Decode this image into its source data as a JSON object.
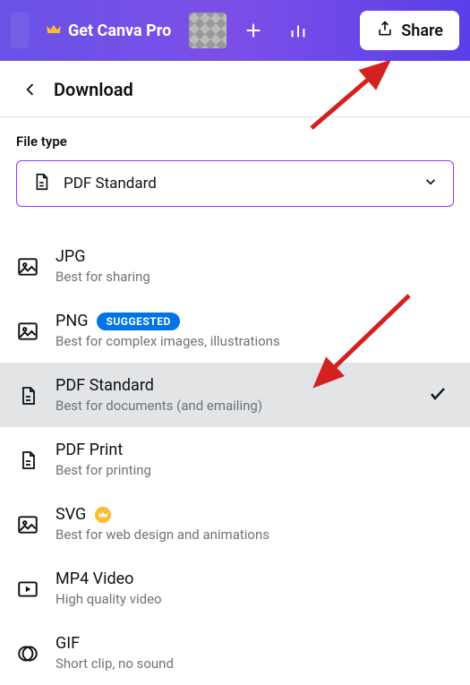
{
  "topbar": {
    "get_pro_label": "Get Canva Pro",
    "share_label": "Share"
  },
  "panel": {
    "title": "Download"
  },
  "file_type": {
    "label": "File type",
    "selected": "PDF Standard"
  },
  "options": [
    {
      "id": "jpg",
      "title": "JPG",
      "subtitle": "Best for sharing",
      "icon": "image",
      "suggested": false,
      "premium": false,
      "selected": false
    },
    {
      "id": "png",
      "title": "PNG",
      "subtitle": "Best for complex images, illustrations",
      "icon": "image",
      "suggested": true,
      "premium": false,
      "selected": false
    },
    {
      "id": "pdf-standard",
      "title": "PDF Standard",
      "subtitle": "Best for documents (and emailing)",
      "icon": "document",
      "suggested": false,
      "premium": false,
      "selected": true
    },
    {
      "id": "pdf-print",
      "title": "PDF Print",
      "subtitle": "Best for printing",
      "icon": "document",
      "suggested": false,
      "premium": false,
      "selected": false
    },
    {
      "id": "svg",
      "title": "SVG",
      "subtitle": "Best for web design and animations",
      "icon": "image",
      "suggested": false,
      "premium": true,
      "selected": false
    },
    {
      "id": "mp4",
      "title": "MP4 Video",
      "subtitle": "High quality video",
      "icon": "video",
      "suggested": false,
      "premium": false,
      "selected": false
    },
    {
      "id": "gif",
      "title": "GIF",
      "subtitle": "Short clip, no sound",
      "icon": "gif",
      "suggested": false,
      "premium": false,
      "selected": false
    }
  ],
  "badges": {
    "suggested": "SUGGESTED"
  },
  "colors": {
    "accent": "#8b3dff",
    "suggested_badge": "#0073e6",
    "premium": "#fdbb2d",
    "arrow": "#d32121"
  }
}
